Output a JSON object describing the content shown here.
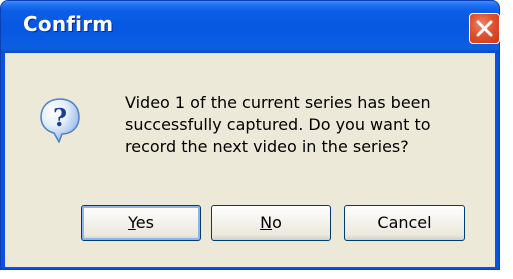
{
  "dialog": {
    "title": "Confirm",
    "message": "Video 1 of the current series has been successfully captured. Do you want to record the next video in the series?",
    "icon": "help-question-icon",
    "buttons": {
      "yes_label": "Yes",
      "no_label": "No",
      "cancel_label": "Cancel"
    }
  },
  "colors": {
    "titlebar": "#0758e0",
    "client_bg": "#ece9d8",
    "close_button": "#e0522c",
    "button_border": "#003c74"
  }
}
